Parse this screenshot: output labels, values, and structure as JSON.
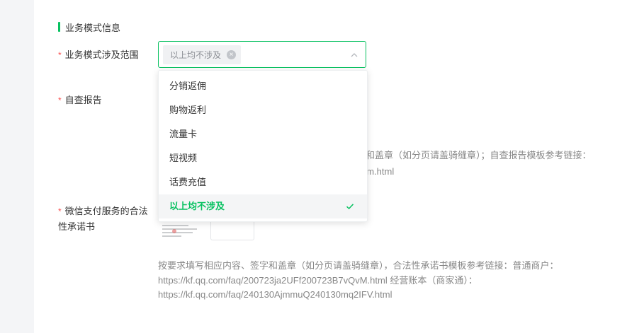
{
  "section": {
    "title": "业务模式信息"
  },
  "fields": {
    "scope": {
      "required_mark": "*",
      "label": "业务模式涉及范围",
      "selected_tag": "以上均不涉及",
      "tag_close": "×"
    },
    "report": {
      "required_mark": "*",
      "label": "自查报告"
    },
    "promise": {
      "required_mark": "*",
      "label": "微信支付服务的合法性承诺书"
    }
  },
  "dropdown": {
    "options": [
      {
        "label": "分销返佣",
        "selected": false
      },
      {
        "label": "购物返利",
        "selected": false
      },
      {
        "label": "流量卡",
        "selected": false
      },
      {
        "label": "短视频",
        "selected": false
      },
      {
        "label": "话费充值",
        "selected": false
      },
      {
        "label": "以上均不涉及",
        "selected": true
      }
    ]
  },
  "report_hint": {
    "line1_partial": "签字和盖章（如分页请盖骑缝章）；自查报告模板参考链接：",
    "line2_partial": "2m.html"
  },
  "promise_hint": {
    "line1": "按要求填写相应内容、签字和盖章（如分页请盖骑缝章），合法性承诺书模板参考链接：普通商户：",
    "line2": "https://kf.qq.com/faq/200723ja2UFf200723B7vQvM.html 经营账本（商家通）：",
    "line3": "https://kf.qq.com/faq/240130AjmmuQ240130mq2IFV.html"
  },
  "colors": {
    "accent": "#07c160",
    "required": "#fa5151",
    "hint": "#888888"
  }
}
